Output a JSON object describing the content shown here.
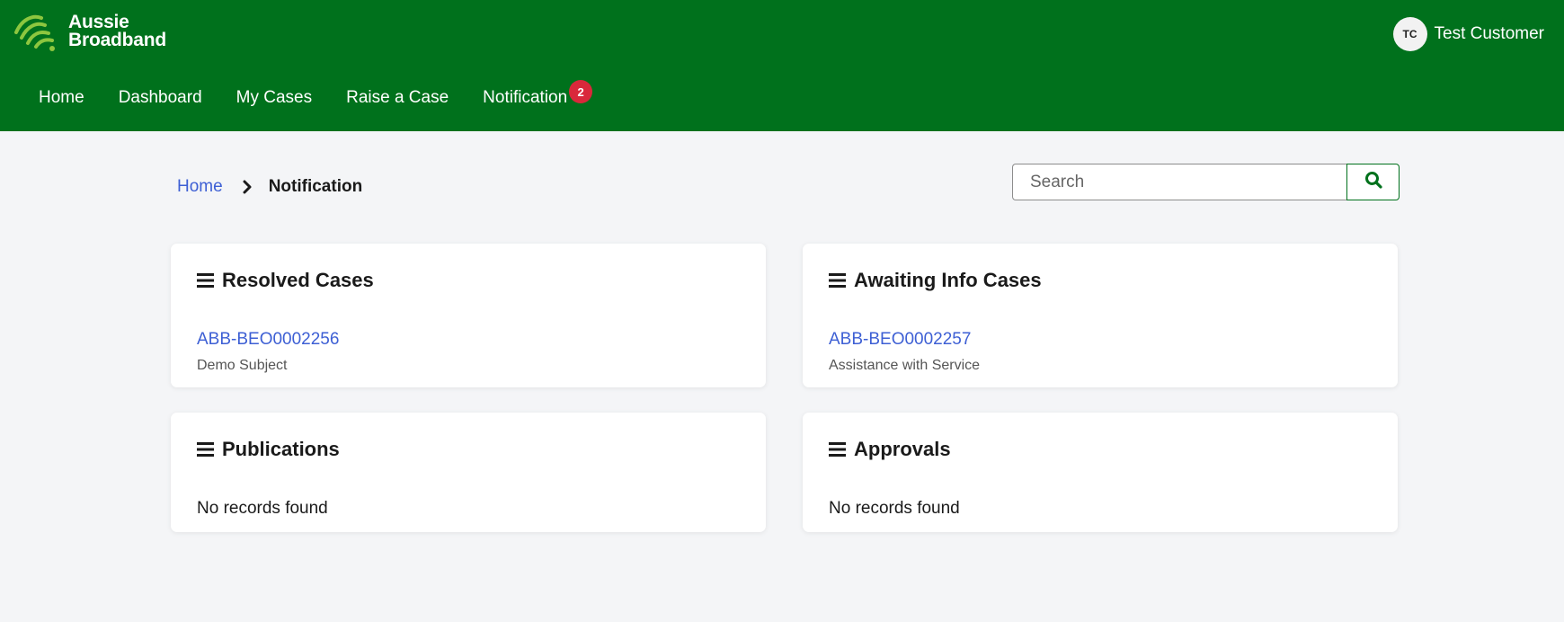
{
  "brand": {
    "name_line1": "Aussie",
    "name_line2": "Broadband",
    "color": "#00711c",
    "accent": "#8dc63f"
  },
  "user": {
    "initials": "TC",
    "name": "Test Customer"
  },
  "nav": {
    "items": [
      {
        "label": "Home"
      },
      {
        "label": "Dashboard"
      },
      {
        "label": "My Cases"
      },
      {
        "label": "Raise a Case"
      },
      {
        "label": "Notification",
        "badge": "2"
      }
    ]
  },
  "breadcrumb": {
    "home": "Home",
    "current": "Notification"
  },
  "search": {
    "placeholder": "Search",
    "value": ""
  },
  "cards": {
    "resolved": {
      "title": "Resolved Cases",
      "case_id": "ABB-BEO0002256",
      "subject": "Demo Subject"
    },
    "awaiting": {
      "title": "Awaiting Info Cases",
      "case_id": "ABB-BEO0002257",
      "subject": "Assistance with Service"
    },
    "publications": {
      "title": "Publications",
      "empty": "No records found"
    },
    "approvals": {
      "title": "Approvals",
      "empty": "No records found"
    }
  },
  "icons": {
    "logo": "aussie-broadband-wifi-logo-icon",
    "menu": "hamburger-menu-icon",
    "breadcrumb_separator": "chevron-right-icon",
    "search": "search-icon"
  },
  "colors": {
    "header_bg": "#00711c",
    "link": "#3d5fd4",
    "badge": "#d9283b",
    "page_bg": "#f4f5f7"
  }
}
